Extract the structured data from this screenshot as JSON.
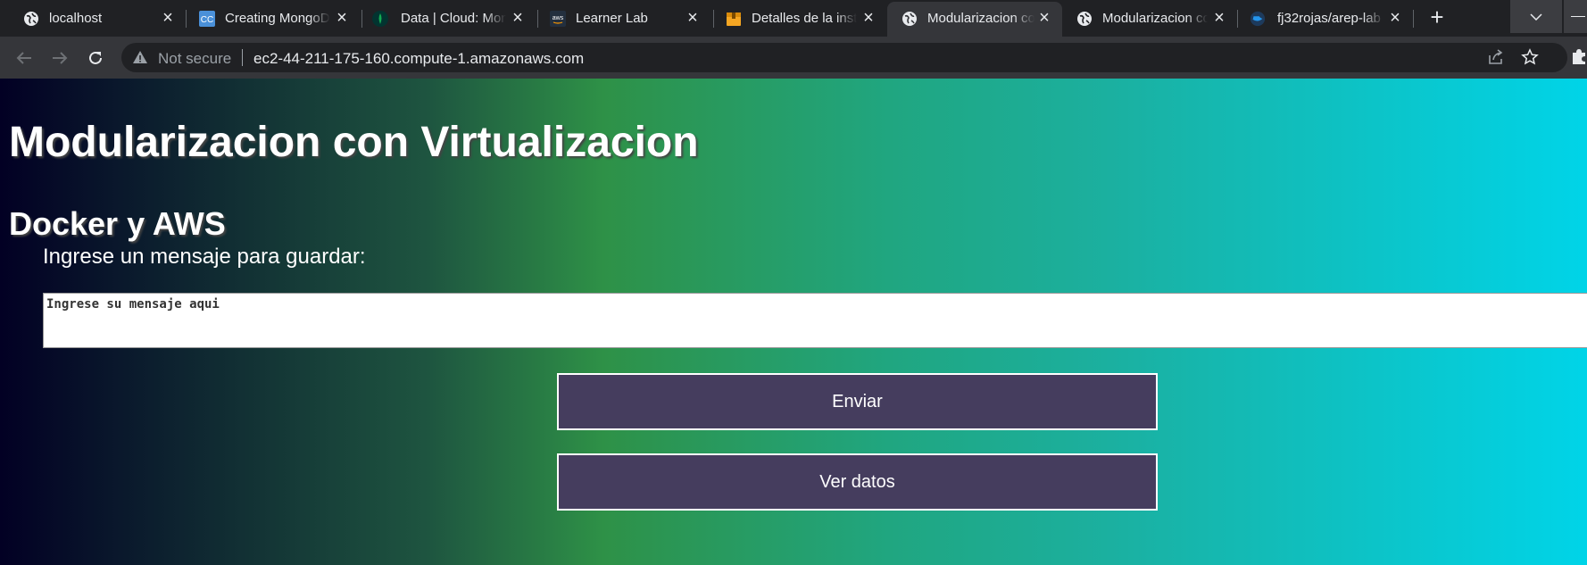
{
  "browser": {
    "tabs": [
      {
        "title": "localhost",
        "favicon": "globe-icon",
        "active": false
      },
      {
        "title": "Creating MongoDB",
        "favicon": "codecommit-cc-icon",
        "active": false
      },
      {
        "title": "Data | Cloud: MongoDB",
        "favicon": "mongodb-leaf-icon",
        "active": false
      },
      {
        "title": "Learner Lab",
        "favicon": "aws-icon",
        "active": false
      },
      {
        "title": "Detalles de la instancia",
        "favicon": "package-box-icon",
        "active": false
      },
      {
        "title": "Modularizacion con Virtualizacion",
        "favicon": "globe-icon",
        "active": true
      },
      {
        "title": "Modularizacion con Virtualizacion",
        "favicon": "globe-icon",
        "active": false
      },
      {
        "title": "fj32rojas/arep-lab",
        "favicon": "docker-icon",
        "active": false
      }
    ],
    "address_bar": {
      "security_label": "Not secure",
      "url": "ec2-44-211-175-160.compute-1.amazonaws.com"
    }
  },
  "page": {
    "title": "Modularizacion con Virtualizacion",
    "subtitle": "Docker y AWS",
    "prompt_label": "Ingrese un mensaje para guardar:",
    "message_placeholder": "Ingrese su mensaje aqui",
    "send_button": "Enviar",
    "view_button": "Ver datos"
  },
  "colors": {
    "button_bg": "#453d5e",
    "gradient_start": "#020024",
    "gradient_mid": "#2e9147",
    "gradient_end": "#00d4e8"
  }
}
